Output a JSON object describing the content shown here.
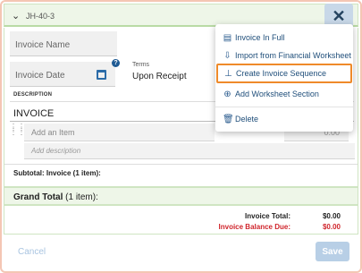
{
  "header": {
    "job_id": "JH-40-3",
    "close_label": "✕"
  },
  "form": {
    "invoice_name_placeholder": "Invoice Name",
    "invoice_date_placeholder": "Invoice Date",
    "terms_label": "Terms",
    "terms_value": "Upon Receipt",
    "help_glyph": "?"
  },
  "lines": {
    "description_header": "DESCRIPTION",
    "section_name": "INVOICE",
    "add_item_placeholder": "Add an Item",
    "add_description_placeholder": "Add description",
    "amount_placeholder": "0.00",
    "subtotal_prefix": "Subtotal: Invoice",
    "subtotal_suffix": " (1 item):",
    "grand_total_prefix": "Grand Total",
    "grand_total_suffix": " (1 item):"
  },
  "totals": {
    "invoice_total_label": "Invoice Total:",
    "invoice_total_value": "$0.00",
    "balance_due_label": "Invoice Balance Due:",
    "balance_due_value": "$0.00"
  },
  "footer": {
    "cancel_label": "Cancel",
    "save_label": "Save"
  },
  "menu": {
    "items": [
      {
        "label": "Invoice In Full",
        "icon": "document-icon"
      },
      {
        "label": "Import from Financial Worksheet",
        "icon": "import-icon"
      },
      {
        "label": "Create Invoice Sequence",
        "icon": "hierarchy-icon",
        "highlighted": true
      },
      {
        "label": "Add Worksheet Section",
        "icon": "plus-circle-icon"
      },
      {
        "label": "Delete",
        "icon": "trash-icon"
      }
    ]
  },
  "colors": {
    "accent": "#1f4e7a",
    "balance_due": "#d0262d",
    "highlight_outline": "#ef8a2a",
    "header_green": "#eef6e8"
  }
}
